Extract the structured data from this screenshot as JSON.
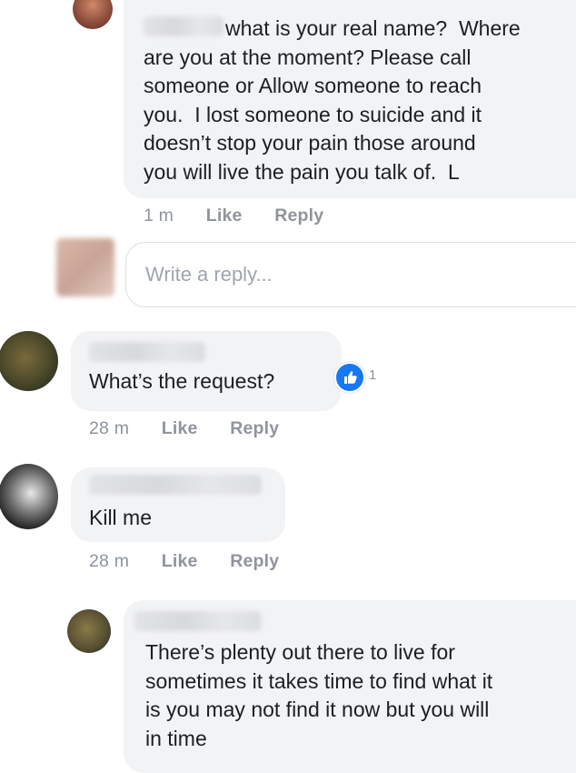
{
  "comments": [
    {
      "text": "what is your real name?  Where\nare you at the moment? Please call\nsomeone or Allow someone to reach\nyou.  I lost someone to suicide and it\ndoesn’t stop your pain those around\nyou will live the pain you talk of.  L",
      "time": "1 m",
      "like_label": "Like",
      "reply_label": "Reply"
    },
    {
      "text": "What’s the request?",
      "reaction_count": "1",
      "time": "28 m",
      "like_label": "Like",
      "reply_label": "Reply"
    },
    {
      "text": "Kill me",
      "time": "28 m",
      "like_label": "Like",
      "reply_label": "Reply"
    },
    {
      "text": "There’s plenty out there to live for\nsometimes it takes time to find what it\nis you may not find it now but you will\nin time"
    }
  ],
  "reply_input": {
    "placeholder": "Write a reply..."
  },
  "colors": {
    "bubble": "#f2f3f5",
    "meta_text": "#8d949e",
    "like_blue": "#1877f2"
  },
  "icons": [
    "thumbs-up-icon"
  ]
}
